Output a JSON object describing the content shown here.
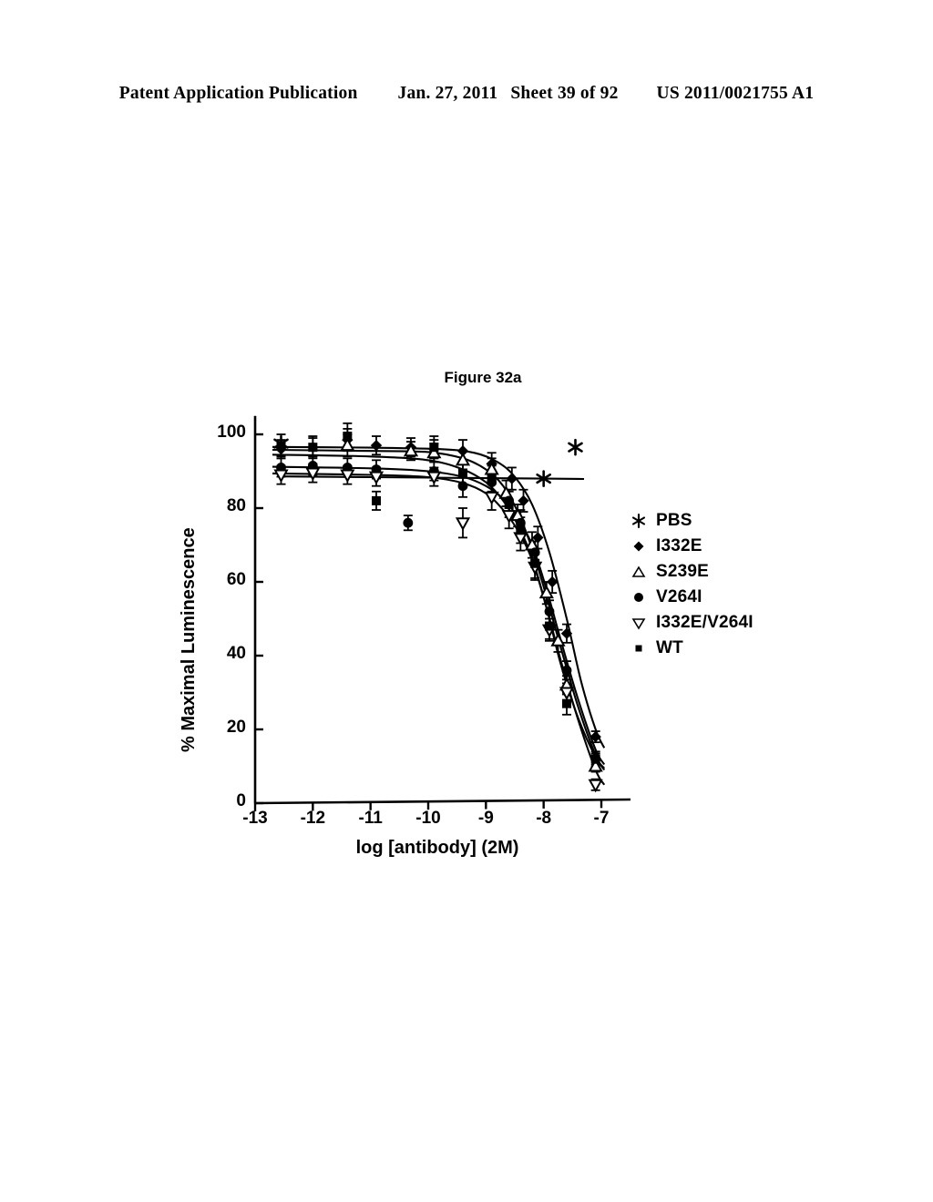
{
  "header": {
    "publication": "Patent Application Publication",
    "date": "Jan. 27, 2011",
    "sheet": "Sheet 39 of 92",
    "pub_number": "US 2011/0021755 A1"
  },
  "figure": {
    "title": "Figure 32a"
  },
  "chart_data": {
    "type": "line",
    "title": "Figure 32a",
    "xlabel": "log [antibody] (2M)",
    "ylabel": "% Maximal Luminescence",
    "xlim": [
      -13,
      -6.7
    ],
    "ylim": [
      0,
      105
    ],
    "xticks": [
      -13,
      -12,
      -11,
      -10,
      -9,
      -8,
      -7
    ],
    "xticklabels": [
      "-13",
      "-12",
      "-11",
      "-10",
      "-9",
      "-8",
      "-7"
    ],
    "yticks": [
      0,
      20,
      40,
      60,
      80,
      100
    ],
    "yticklabels": [
      "0",
      "20",
      "40",
      "60",
      "80",
      "100"
    ],
    "grid": false,
    "legend_position": "right",
    "error_bars": true,
    "series": [
      {
        "name": "PBS",
        "marker": "asterisk",
        "fill": "solid",
        "x": [
          -12.55,
          -8.0,
          -7.45
        ],
        "y": [
          97.5,
          88.0,
          96.5
        ],
        "err": [
          0,
          0,
          0
        ],
        "curve": [
          {
            "x": -12.55,
            "y": 88.6
          },
          {
            "x": -11.0,
            "y": 88.4
          },
          {
            "x": -9.5,
            "y": 88.2
          },
          {
            "x": -8.0,
            "y": 88.0
          },
          {
            "x": -7.3,
            "y": 87.9
          }
        ]
      },
      {
        "name": "I332E",
        "marker": "diamond",
        "fill": "solid",
        "x": [
          -12.55,
          -12.0,
          -11.4,
          -10.9,
          -10.3,
          -9.9,
          -9.4,
          -8.9,
          -8.55,
          -8.35,
          -8.1,
          -7.85,
          -7.6,
          -7.1
        ],
        "y": [
          96.0,
          96.5,
          98.5,
          97.0,
          96.5,
          96.0,
          95.5,
          92.0,
          88.0,
          82.0,
          72.0,
          60.0,
          46.0,
          18.0
        ],
        "err": [
          2.5,
          2.5,
          3.0,
          2.5,
          2.5,
          2.5,
          3.0,
          3.0,
          3.0,
          3.0,
          3.0,
          3.0,
          2.5,
          1.5
        ],
        "curve": [
          {
            "x": -12.7,
            "y": 96.6
          },
          {
            "x": -11.0,
            "y": 96.4
          },
          {
            "x": -9.8,
            "y": 96.0
          },
          {
            "x": -9.2,
            "y": 95.0
          },
          {
            "x": -8.8,
            "y": 92.5
          },
          {
            "x": -8.5,
            "y": 88.5
          },
          {
            "x": -8.2,
            "y": 81.0
          },
          {
            "x": -7.9,
            "y": 68.0
          },
          {
            "x": -7.6,
            "y": 50.0
          },
          {
            "x": -7.35,
            "y": 33.0
          },
          {
            "x": -7.1,
            "y": 20.0
          },
          {
            "x": -6.95,
            "y": 15.0
          }
        ]
      },
      {
        "name": "S239E",
        "marker": "triangle-up",
        "fill": "open",
        "x": [
          -11.4,
          -10.3,
          -9.9,
          -9.4,
          -8.9,
          -8.65,
          -8.45,
          -8.2,
          -7.95,
          -7.75,
          -7.6,
          -7.1
        ],
        "y": [
          97.0,
          95.5,
          95.0,
          93.0,
          90.5,
          84.0,
          78.0,
          70.0,
          57.0,
          44.0,
          32.0,
          10.0
        ],
        "err": [
          3.0,
          2.5,
          2.5,
          2.5,
          3.0,
          3.5,
          3.0,
          3.5,
          3.0,
          3.0,
          2.5,
          1.5
        ],
        "curve": [
          {
            "x": -12.7,
            "y": 95.8
          },
          {
            "x": -11.0,
            "y": 95.5
          },
          {
            "x": -10.0,
            "y": 95.2
          },
          {
            "x": -9.4,
            "y": 93.5
          },
          {
            "x": -9.0,
            "y": 90.5
          },
          {
            "x": -8.7,
            "y": 86.0
          },
          {
            "x": -8.45,
            "y": 79.0
          },
          {
            "x": -8.2,
            "y": 69.0
          },
          {
            "x": -7.95,
            "y": 56.0
          },
          {
            "x": -7.7,
            "y": 42.0
          },
          {
            "x": -7.4,
            "y": 26.0
          },
          {
            "x": -7.1,
            "y": 13.0
          },
          {
            "x": -6.95,
            "y": 9.0
          }
        ]
      },
      {
        "name": "V264I",
        "marker": "circle",
        "fill": "solid",
        "x": [
          -12.55,
          -12.0,
          -11.4,
          -10.9,
          -10.35,
          -9.9,
          -9.4,
          -8.9,
          -8.6,
          -8.4,
          -8.15,
          -7.9,
          -7.6,
          -7.1
        ],
        "y": [
          91.0,
          91.5,
          91.0,
          90.5,
          76.0,
          90.0,
          86.0,
          87.0,
          82.0,
          76.0,
          68.0,
          52.0,
          36.0,
          12.0
        ],
        "err": [
          2.5,
          2.5,
          2.5,
          2.5,
          2.0,
          2.5,
          3.0,
          3.0,
          3.0,
          3.5,
          3.0,
          3.0,
          2.5,
          1.5
        ],
        "curve": [
          {
            "x": -12.7,
            "y": 91.2
          },
          {
            "x": -11.0,
            "y": 90.8
          },
          {
            "x": -10.0,
            "y": 90.0
          },
          {
            "x": -9.4,
            "y": 88.5
          },
          {
            "x": -9.0,
            "y": 86.0
          },
          {
            "x": -8.7,
            "y": 82.5
          },
          {
            "x": -8.45,
            "y": 77.5
          },
          {
            "x": -8.2,
            "y": 70.0
          },
          {
            "x": -7.95,
            "y": 58.0
          },
          {
            "x": -7.7,
            "y": 44.0
          },
          {
            "x": -7.4,
            "y": 28.0
          },
          {
            "x": -7.1,
            "y": 14.5
          },
          {
            "x": -6.95,
            "y": 10.5
          }
        ]
      },
      {
        "name": "I332E/V264I",
        "marker": "triangle-down",
        "fill": "open",
        "x": [
          -12.55,
          -12.0,
          -11.4,
          -10.9,
          -9.9,
          -9.4,
          -8.9,
          -8.6,
          -8.4,
          -8.15,
          -7.9,
          -7.6,
          -7.1
        ],
        "y": [
          89.0,
          89.5,
          89.0,
          88.5,
          88.5,
          76.0,
          83.0,
          78.0,
          72.0,
          64.0,
          47.0,
          30.0,
          5.0
        ],
        "err": [
          2.5,
          2.5,
          2.5,
          2.5,
          2.5,
          4.0,
          3.5,
          3.5,
          3.5,
          3.5,
          3.0,
          2.5,
          1.5
        ],
        "curve": [
          {
            "x": -12.7,
            "y": 89.4
          },
          {
            "x": -11.0,
            "y": 89.0
          },
          {
            "x": -10.0,
            "y": 88.4
          },
          {
            "x": -9.4,
            "y": 86.8
          },
          {
            "x": -9.0,
            "y": 84.0
          },
          {
            "x": -8.7,
            "y": 79.5
          },
          {
            "x": -8.45,
            "y": 74.0
          },
          {
            "x": -8.2,
            "y": 66.0
          },
          {
            "x": -7.95,
            "y": 53.0
          },
          {
            "x": -7.7,
            "y": 38.5
          },
          {
            "x": -7.4,
            "y": 22.5
          },
          {
            "x": -7.1,
            "y": 9.0
          },
          {
            "x": -6.95,
            "y": 5.0
          }
        ]
      },
      {
        "name": "WT",
        "marker": "square",
        "fill": "solid",
        "x": [
          -12.55,
          -12.0,
          -11.4,
          -10.9,
          -9.9,
          -9.4,
          -8.9,
          -8.6,
          -8.4,
          -8.15,
          -7.9,
          -7.6,
          -7.1
        ],
        "y": [
          97.0,
          96.5,
          99.5,
          82.0,
          96.5,
          89.5,
          88.0,
          81.0,
          74.0,
          65.0,
          48.0,
          27.0,
          12.0
        ],
        "err": [
          3.0,
          3.0,
          3.5,
          2.5,
          3.0,
          3.0,
          3.5,
          3.5,
          3.5,
          4.0,
          3.5,
          3.0,
          2.0
        ],
        "curve": [
          {
            "x": -12.7,
            "y": 94.5
          },
          {
            "x": -11.0,
            "y": 94.0
          },
          {
            "x": -10.0,
            "y": 93.0
          },
          {
            "x": -9.4,
            "y": 90.5
          },
          {
            "x": -9.0,
            "y": 87.0
          },
          {
            "x": -8.7,
            "y": 82.0
          },
          {
            "x": -8.45,
            "y": 75.5
          },
          {
            "x": -8.2,
            "y": 66.5
          },
          {
            "x": -7.95,
            "y": 53.0
          },
          {
            "x": -7.7,
            "y": 37.5
          },
          {
            "x": -7.4,
            "y": 23.0
          },
          {
            "x": -7.1,
            "y": 12.5
          },
          {
            "x": -6.95,
            "y": 9.5
          }
        ]
      }
    ]
  },
  "legend": {
    "items": [
      {
        "label": "PBS",
        "marker": "asterisk"
      },
      {
        "label": "I332E",
        "marker": "diamond"
      },
      {
        "label": "S239E",
        "marker": "triangle-up"
      },
      {
        "label": "V264I",
        "marker": "circle"
      },
      {
        "label": "I332E/V264I",
        "marker": "triangle-down"
      },
      {
        "label": "WT",
        "marker": "square"
      }
    ]
  }
}
